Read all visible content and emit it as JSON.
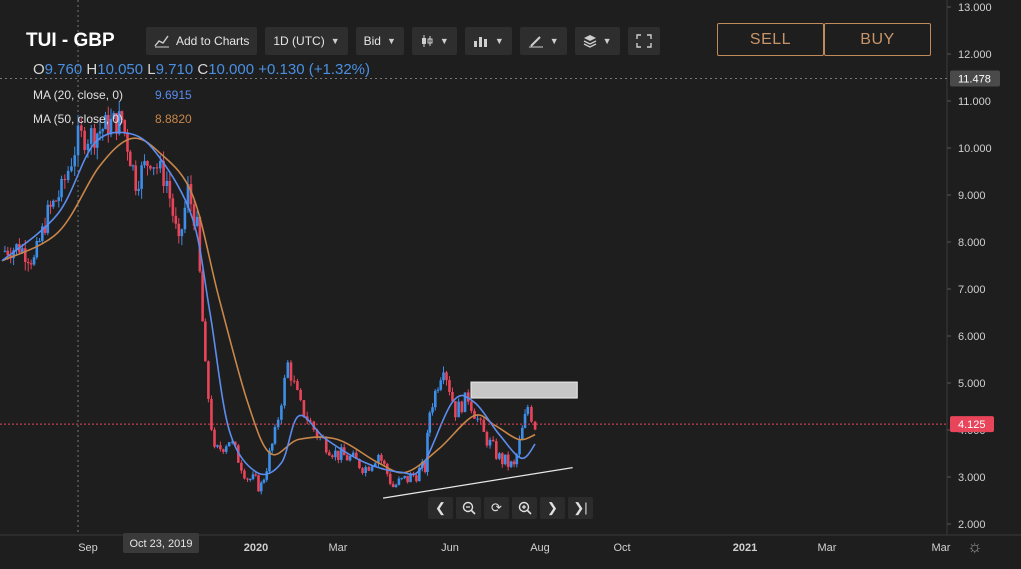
{
  "header": {
    "symbol": "TUI - GBP",
    "ohlc": {
      "o_label": "O",
      "o_value": "9.760",
      "h_label": "H",
      "h_value": "10.050",
      "l_label": "L",
      "l_value": "9.710",
      "c_label": "C",
      "c_value": "10.000",
      "change": "+0.130 (+1.32%)"
    },
    "indicators": [
      {
        "label": "MA (20, close, 0)",
        "value": "9.6915",
        "color": "#5b8def"
      },
      {
        "label": "MA (50, close, 0)",
        "value": "8.8820",
        "color": "#c8864a"
      }
    ]
  },
  "toolbar": {
    "add_to_charts": "Add to Charts",
    "interval": "1D (UTC)",
    "price_type": "Bid",
    "icons": [
      "add-chart-icon",
      "candles-icon",
      "indicators-icon",
      "drawing-icon",
      "layers-icon",
      "fullscreen-icon"
    ]
  },
  "trade": {
    "sell_label": "SELL",
    "buy_label": "BUY"
  },
  "navigation": {
    "icons": [
      "scroll-left-icon",
      "zoom-out-icon",
      "reset-icon",
      "zoom-in-icon",
      "scroll-right-icon",
      "go-to-end-icon"
    ],
    "settings_icon": "gear-icon"
  },
  "colors": {
    "background": "#1e1e1e",
    "up": "#3d8ee8",
    "down": "#e8445a",
    "ma20": "#5b8def",
    "ma50": "#c8864a",
    "accent": "#c08a5a"
  },
  "chart_data": {
    "type": "candlestick",
    "x_ticks": [
      "Sep",
      "2020",
      "Mar",
      "Jun",
      "Aug",
      "Oct",
      "2021",
      "Mar",
      "Mar"
    ],
    "y_ticks": [
      "13.000",
      "12.000",
      "11.000",
      "10.000",
      "9.000",
      "8.000",
      "7.000",
      "6.000",
      "5.000",
      "4.000",
      "3.000",
      "2.000"
    ],
    "ylim": [
      2.0,
      13.0
    ],
    "crosshair": {
      "date_label": "Oct 23, 2019",
      "price_label": "11.478"
    },
    "last_price": "4.125",
    "price_series": [
      {
        "x": "2019-08-01",
        "close": 7.8
      },
      {
        "x": "2019-08-20",
        "close": 7.9
      },
      {
        "x": "2019-09-05",
        "close": 7.6
      },
      {
        "x": "2019-09-20",
        "close": 8.6
      },
      {
        "x": "2019-10-05",
        "close": 9.1
      },
      {
        "x": "2019-10-23",
        "close": 10.2
      },
      {
        "x": "2019-11-10",
        "close": 10.3
      },
      {
        "x": "2019-11-25",
        "close": 10.5
      },
      {
        "x": "2019-12-10",
        "close": 10.6
      },
      {
        "x": "2019-12-25",
        "close": 9.3
      },
      {
        "x": "2020-01-10",
        "close": 9.8
      },
      {
        "x": "2020-01-28",
        "close": 9.3
      },
      {
        "x": "2020-02-10",
        "close": 7.9
      },
      {
        "x": "2020-02-20",
        "close": 9.1
      },
      {
        "x": "2020-03-01",
        "close": 8.3
      },
      {
        "x": "2020-03-10",
        "close": 5.3
      },
      {
        "x": "2020-03-20",
        "close": 3.5
      },
      {
        "x": "2020-04-05",
        "close": 3.8
      },
      {
        "x": "2020-04-25",
        "close": 3.0
      },
      {
        "x": "2020-05-10",
        "close": 2.8
      },
      {
        "x": "2020-05-25",
        "close": 3.9
      },
      {
        "x": "2020-06-08",
        "close": 5.4
      },
      {
        "x": "2020-06-22",
        "close": 4.5
      },
      {
        "x": "2020-07-10",
        "close": 3.9
      },
      {
        "x": "2020-07-30",
        "close": 3.5
      },
      {
        "x": "2020-08-15",
        "close": 3.4
      },
      {
        "x": "2020-09-01",
        "close": 3.2
      },
      {
        "x": "2020-09-15",
        "close": 3.5
      },
      {
        "x": "2020-10-01",
        "close": 2.8
      },
      {
        "x": "2020-10-20",
        "close": 3.0
      },
      {
        "x": "2020-11-05",
        "close": 3.2
      },
      {
        "x": "2020-11-10",
        "close": 4.4
      },
      {
        "x": "2020-11-25",
        "close": 5.4
      },
      {
        "x": "2020-12-08",
        "close": 4.4
      },
      {
        "x": "2020-12-22",
        "close": 4.7
      },
      {
        "x": "2021-01-08",
        "close": 3.9
      },
      {
        "x": "2021-01-25",
        "close": 3.4
      },
      {
        "x": "2021-02-10",
        "close": 3.2
      },
      {
        "x": "2021-02-25",
        "close": 4.5
      },
      {
        "x": "2021-03-05",
        "close": 4.1
      }
    ],
    "ma20": [
      {
        "x": "2019-08-01",
        "y": 7.6
      },
      {
        "x": "2019-10-01",
        "y": 8.6
      },
      {
        "x": "2019-11-10",
        "y": 10.1
      },
      {
        "x": "2019-12-20",
        "y": 10.3
      },
      {
        "x": "2020-01-20",
        "y": 9.8
      },
      {
        "x": "2020-02-25",
        "y": 8.5
      },
      {
        "x": "2020-03-15",
        "y": 6.5
      },
      {
        "x": "2020-04-05",
        "y": 4.0
      },
      {
        "x": "2020-05-05",
        "y": 3.1
      },
      {
        "x": "2020-06-01",
        "y": 3.3
      },
      {
        "x": "2020-06-20",
        "y": 4.3
      },
      {
        "x": "2020-07-20",
        "y": 3.8
      },
      {
        "x": "2020-09-01",
        "y": 3.3
      },
      {
        "x": "2020-10-10",
        "y": 3.1
      },
      {
        "x": "2020-11-01",
        "y": 3.2
      },
      {
        "x": "2020-12-05",
        "y": 4.6
      },
      {
        "x": "2020-12-28",
        "y": 4.6
      },
      {
        "x": "2021-01-25",
        "y": 3.9
      },
      {
        "x": "2021-02-18",
        "y": 3.4
      },
      {
        "x": "2021-03-05",
        "y": 3.7
      }
    ],
    "ma50": [
      {
        "x": "2019-08-01",
        "y": 7.6
      },
      {
        "x": "2019-10-01",
        "y": 8.2
      },
      {
        "x": "2019-11-15",
        "y": 9.6
      },
      {
        "x": "2019-12-20",
        "y": 10.2
      },
      {
        "x": "2020-01-20",
        "y": 9.9
      },
      {
        "x": "2020-02-25",
        "y": 9.0
      },
      {
        "x": "2020-03-25",
        "y": 6.8
      },
      {
        "x": "2020-04-25",
        "y": 4.6
      },
      {
        "x": "2020-05-20",
        "y": 3.5
      },
      {
        "x": "2020-06-20",
        "y": 3.8
      },
      {
        "x": "2020-08-01",
        "y": 3.8
      },
      {
        "x": "2020-09-15",
        "y": 3.3
      },
      {
        "x": "2020-10-15",
        "y": 3.1
      },
      {
        "x": "2020-11-20",
        "y": 3.6
      },
      {
        "x": "2020-12-28",
        "y": 4.3
      },
      {
        "x": "2021-01-20",
        "y": 4.1
      },
      {
        "x": "2021-02-15",
        "y": 3.8
      },
      {
        "x": "2021-03-05",
        "y": 3.9
      }
    ],
    "trendline": {
      "start": {
        "x": "2020-09-20",
        "y": 2.55
      },
      "end": {
        "x": "2021-04-15",
        "y": 3.2
      }
    },
    "resistance_zone": {
      "x_start": "2020-12-25",
      "x_end": "2021-04-20",
      "y_low": 4.68,
      "y_high": 5.02
    }
  }
}
